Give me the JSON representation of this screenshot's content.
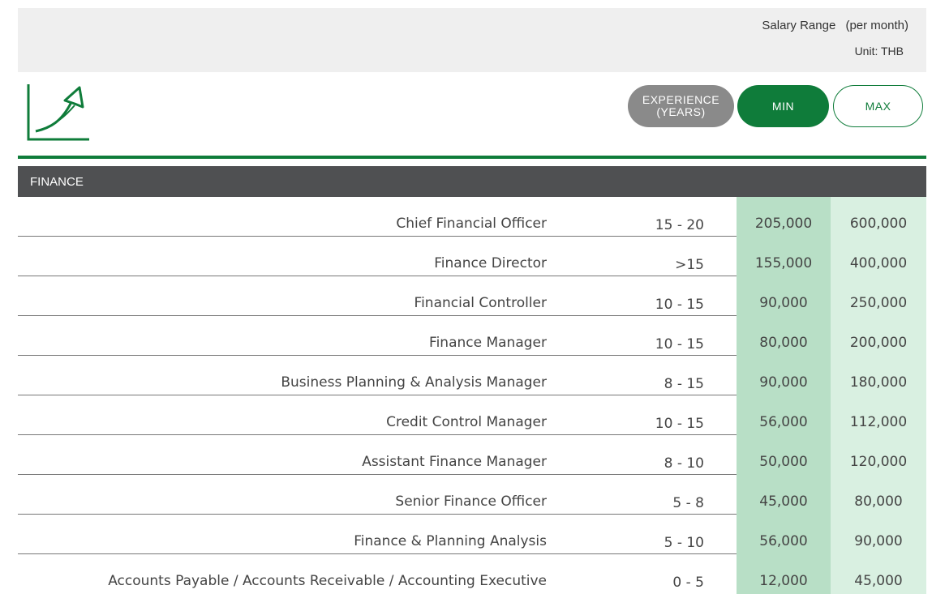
{
  "header": {
    "range_label": "Salary Range",
    "range_sub": "(per month)",
    "unit": "Unit: THB"
  },
  "legend": {
    "experience": "EXPERIENCE\n(YEARS)",
    "min": "MIN",
    "max": "MAX"
  },
  "colors": {
    "accent": "#0f7c3a",
    "header_bar": "#4f5052",
    "min_column": "#b8dfc6",
    "max_column": "#d9f0e1"
  },
  "icon": "growth-arrow-icon",
  "section": {
    "title": "FINANCE",
    "rows": [
      {
        "title": "Chief Financial Officer",
        "experience": "15 - 20",
        "min": "205,000",
        "max": "600,000"
      },
      {
        "title": "Finance Director",
        "experience": ">15",
        "min": "155,000",
        "max": "400,000"
      },
      {
        "title": "Financial Controller",
        "experience": "10 - 15",
        "min": "90,000",
        "max": "250,000"
      },
      {
        "title": "Finance Manager",
        "experience": "10 - 15",
        "min": "80,000",
        "max": "200,000"
      },
      {
        "title": "Business Planning & Analysis Manager",
        "experience": "8 - 15",
        "min": "90,000",
        "max": "180,000"
      },
      {
        "title": "Credit Control Manager",
        "experience": "10 - 15",
        "min": "56,000",
        "max": "112,000"
      },
      {
        "title": "Assistant Finance Manager",
        "experience": "8 - 10",
        "min": "50,000",
        "max": "120,000"
      },
      {
        "title": "Senior Finance Officer",
        "experience": "5 - 8",
        "min": "45,000",
        "max": "80,000"
      },
      {
        "title": "Finance & Planning Analysis",
        "experience": "5 - 10",
        "min": "56,000",
        "max": "90,000"
      },
      {
        "title": "Accounts Payable / Accounts Receivable / Accounting Executive",
        "experience": "0 - 5",
        "min": "12,000",
        "max": "45,000"
      }
    ]
  }
}
